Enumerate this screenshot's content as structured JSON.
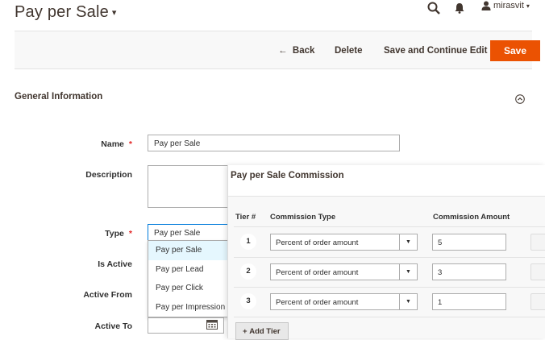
{
  "header": {
    "title": "Pay per Sale",
    "user": "mirasvit"
  },
  "toolbar": {
    "back_label": "Back",
    "delete_label": "Delete",
    "save_continue_label": "Save and Continue Edit",
    "save_label": "Save"
  },
  "section": {
    "title": "General Information"
  },
  "form": {
    "name_label": "Name",
    "name_value": "Pay per Sale",
    "description_label": "Description",
    "type_label": "Type",
    "type_value": "Pay per Sale",
    "is_active_label": "Is Active",
    "active_from_label": "Active From",
    "active_to_label": "Active To",
    "type_options": [
      "Pay per Sale",
      "Pay per Lead",
      "Pay per Click",
      "Pay per Impression"
    ]
  },
  "commission": {
    "title": "Pay per Sale Commission",
    "col_tier": "Tier #",
    "col_type": "Commission Type",
    "col_amount": "Commission Amount",
    "rows": [
      {
        "tier": "1",
        "type": "Percent of order amount",
        "amount": "5"
      },
      {
        "tier": "2",
        "type": "Percent of order amount",
        "amount": "3"
      },
      {
        "tier": "3",
        "type": "Percent of order amount",
        "amount": "1"
      }
    ],
    "add_tier_label": "Add Tier"
  },
  "colors": {
    "accent": "#eb5202",
    "selected_option": "#e5f7fe"
  }
}
